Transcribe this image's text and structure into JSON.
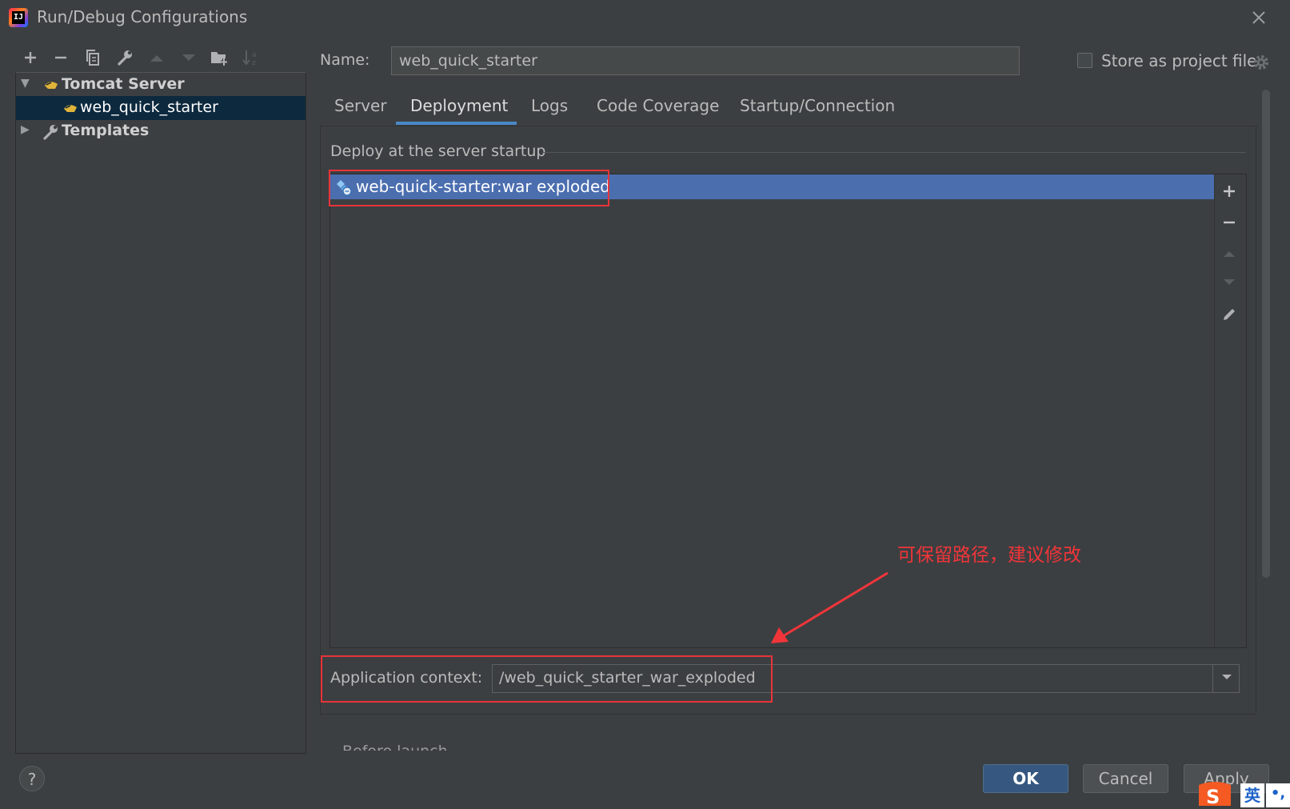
{
  "window": {
    "title": "Run/Debug Configurations"
  },
  "toolbar": {
    "icons": [
      "add-icon",
      "remove-icon",
      "copy-icon",
      "wrench-icon",
      "move-up-icon",
      "move-down-icon",
      "new-folder-icon",
      "sort-icon"
    ]
  },
  "tree": {
    "items": [
      {
        "label": "Tomcat Server",
        "expanded": true
      },
      {
        "label": "web_quick_starter",
        "selected": true
      },
      {
        "label": "Templates",
        "expanded": false
      }
    ]
  },
  "name_row": {
    "label": "Name:",
    "value": "web_quick_starter",
    "store_label": "Store as project file",
    "store_checked": false
  },
  "tabs": [
    {
      "label": "Server"
    },
    {
      "label": "Deployment",
      "active": true
    },
    {
      "label": "Logs"
    },
    {
      "label": "Code Coverage"
    },
    {
      "label": "Startup/Connection"
    }
  ],
  "deployment": {
    "section_title": "Deploy at the server startup",
    "artifacts": [
      {
        "label": "web-quick-starter:war exploded",
        "selected": true
      }
    ],
    "side_buttons": [
      "add-icon",
      "remove-icon",
      "move-up-icon",
      "move-down-icon",
      "edit-icon"
    ],
    "context_label": "Application context:",
    "context_value": "/web_quick_starter_war_exploded"
  },
  "annotation": {
    "text": "可保留路径，建议修改",
    "color": "#f0353a"
  },
  "before_launch": "Before launch",
  "buttons": {
    "ok": "OK",
    "cancel": "Cancel",
    "apply": "Apply",
    "help": "?"
  },
  "ime": {
    "label": "英"
  },
  "colors": {
    "background": "#3c3f41",
    "selection": "#4b6eaf",
    "tree_selection": "#0d293e",
    "accent": "#4a88c7",
    "primary_button": "#365880"
  }
}
